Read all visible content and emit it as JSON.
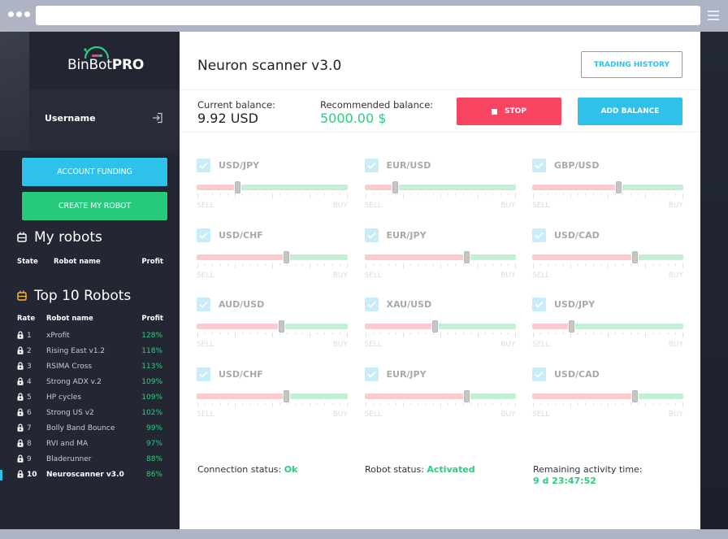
{
  "browser": {
    "menu_icon": "hamburger-icon"
  },
  "sidebar": {
    "logo": {
      "text_light": "BinBot",
      "text_bold": "PRO",
      "colors": {
        "arc": "#2ecc7f",
        "bar_left": "#f74562",
        "bar_right": "#2ecc7f"
      }
    },
    "username": "Username",
    "logout_icon": "sign-in-icon",
    "buttons": {
      "account_funding": "ACCOUNT FUNDING",
      "create_robot": "CREATE MY ROBOT"
    },
    "my_robots": {
      "title": "My robots",
      "icon": "robot-icon",
      "columns": {
        "state": "State",
        "name": "Robot name",
        "profit": "Profit"
      }
    },
    "top10": {
      "title": "Top 10 Robots",
      "icon": "robot-icon",
      "columns": {
        "rate": "Rate",
        "name": "Robot name",
        "profit": "Profit"
      },
      "rows": [
        {
          "rate": "1",
          "name": "xProfit",
          "profit": "128%"
        },
        {
          "rate": "2",
          "name": "Rising East v1.2",
          "profit": "118%"
        },
        {
          "rate": "3",
          "name": "RSIMA Cross",
          "profit": "113%"
        },
        {
          "rate": "4",
          "name": "Strong ADX v.2",
          "profit": "109%"
        },
        {
          "rate": "5",
          "name": "HP cycles",
          "profit": "109%"
        },
        {
          "rate": "6",
          "name": "Strong US v2",
          "profit": "102%"
        },
        {
          "rate": "7",
          "name": "Bolly Band Bounce",
          "profit": "99%"
        },
        {
          "rate": "8",
          "name": "RVI and MA",
          "profit": "97%"
        },
        {
          "rate": "9",
          "name": "Bladerunner",
          "profit": "88%"
        },
        {
          "rate": "10",
          "name": "Neuroscanner v3.0",
          "profit": "86%",
          "active": true
        }
      ]
    }
  },
  "main": {
    "title": "Neuron scanner v3.0",
    "trading_history": "TRADING HISTORY",
    "current_balance": {
      "label": "Current balance:",
      "value": "9.92 USD"
    },
    "recommended_balance": {
      "label": "Recommended balance:",
      "value": "5000.00 $"
    },
    "stop_button": "STOP",
    "add_balance_button": "ADD BALANCE",
    "sell_label": "SELL",
    "buy_label": "BUY",
    "pairs": [
      {
        "name": "USD/JPY",
        "checked": true,
        "sell_fraction": 0.27
      },
      {
        "name": "EUR/USD",
        "checked": true,
        "sell_fraction": 0.2
      },
      {
        "name": "GBP/USD",
        "checked": true,
        "sell_fraction": 0.57
      },
      {
        "name": "USD/CHF",
        "checked": true,
        "sell_fraction": 0.59
      },
      {
        "name": "EUR/JPY",
        "checked": true,
        "sell_fraction": 0.67
      },
      {
        "name": "USD/CAD",
        "checked": true,
        "sell_fraction": 0.68
      },
      {
        "name": "AUD/USD",
        "checked": true,
        "sell_fraction": 0.56
      },
      {
        "name": "XAU/USD",
        "checked": true,
        "sell_fraction": 0.46
      },
      {
        "name": "USD/JPY",
        "checked": true,
        "sell_fraction": 0.26
      },
      {
        "name": "USD/CHF",
        "checked": true,
        "sell_fraction": 0.59
      },
      {
        "name": "EUR/JPY",
        "checked": true,
        "sell_fraction": 0.67
      },
      {
        "name": "USD/CAD",
        "checked": true,
        "sell_fraction": 0.68
      }
    ],
    "status": {
      "connection_label": "Connection status:",
      "connection_value": "Ok",
      "robot_label": "Robot status:",
      "robot_value": "Activated",
      "time_label": "Remaining activity time:",
      "time_value": "9 d 23:47:52"
    },
    "colors": {
      "accent_blue": "#2ec1ea",
      "accent_green": "#2ecc7f",
      "stop_red": "#f74562"
    }
  }
}
